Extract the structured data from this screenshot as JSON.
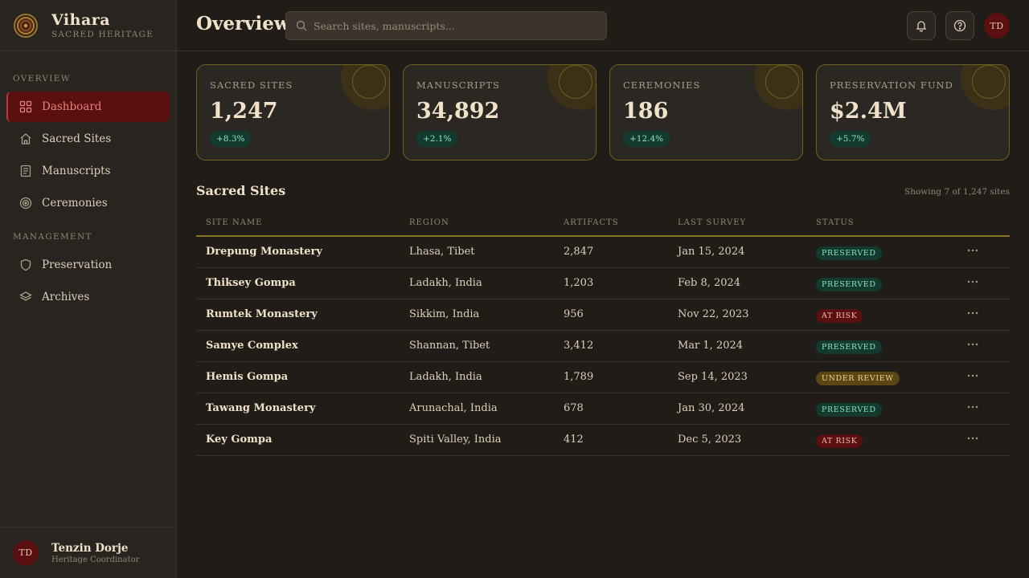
{
  "brand": {
    "name": "Vihara",
    "subtitle": "SACRED HERITAGE"
  },
  "nav": {
    "section_overview": "OVERVIEW",
    "section_management": "MANAGEMENT",
    "items": [
      {
        "label": "Dashboard",
        "icon": "grid-icon",
        "active": true
      },
      {
        "label": "Sacred Sites",
        "icon": "temple-icon"
      },
      {
        "label": "Manuscripts",
        "icon": "document-icon"
      },
      {
        "label": "Ceremonies",
        "icon": "target-icon"
      },
      {
        "label": "Preservation",
        "icon": "shield-icon"
      },
      {
        "label": "Archives",
        "icon": "layers-icon"
      }
    ]
  },
  "user": {
    "initials": "TD",
    "name": "Tenzin Dorje",
    "role": "Heritage Coordinator"
  },
  "header": {
    "title": "Overview",
    "search_placeholder": "Search sites, manuscripts..."
  },
  "stats": [
    {
      "label": "SACRED SITES",
      "value": "1,247",
      "change": "+8.3%"
    },
    {
      "label": "MANUSCRIPTS",
      "value": "34,892",
      "change": "+2.1%"
    },
    {
      "label": "CEREMONIES",
      "value": "186",
      "change": "+12.4%"
    },
    {
      "label": "PRESERVATION FUND",
      "value": "$2.4M",
      "change": "+5.7%"
    }
  ],
  "table": {
    "title": "Sacred Sites",
    "meta": "Showing 7 of 1,247 sites",
    "columns": [
      "SITE NAME",
      "REGION",
      "ARTIFACTS",
      "LAST SURVEY",
      "STATUS"
    ],
    "rows": [
      {
        "name": "Drepung Monastery",
        "region": "Lhasa, Tibet",
        "artifacts": "2,847",
        "survey": "Jan 15, 2024",
        "status": "PRESERVED"
      },
      {
        "name": "Thiksey Gompa",
        "region": "Ladakh, India",
        "artifacts": "1,203",
        "survey": "Feb 8, 2024",
        "status": "PRESERVED"
      },
      {
        "name": "Rumtek Monastery",
        "region": "Sikkim, India",
        "artifacts": "956",
        "survey": "Nov 22, 2023",
        "status": "AT RISK"
      },
      {
        "name": "Samye Complex",
        "region": "Shannan, Tibet",
        "artifacts": "3,412",
        "survey": "Mar 1, 2024",
        "status": "PRESERVED"
      },
      {
        "name": "Hemis Gompa",
        "region": "Ladakh, India",
        "artifacts": "1,789",
        "survey": "Sep 14, 2023",
        "status": "UNDER REVIEW"
      },
      {
        "name": "Tawang Monastery",
        "region": "Arunachal, India",
        "artifacts": "678",
        "survey": "Jan 30, 2024",
        "status": "PRESERVED"
      },
      {
        "name": "Key Gompa",
        "region": "Spiti Valley, India",
        "artifacts": "412",
        "survey": "Dec 5, 2023",
        "status": "AT RISK"
      }
    ]
  }
}
